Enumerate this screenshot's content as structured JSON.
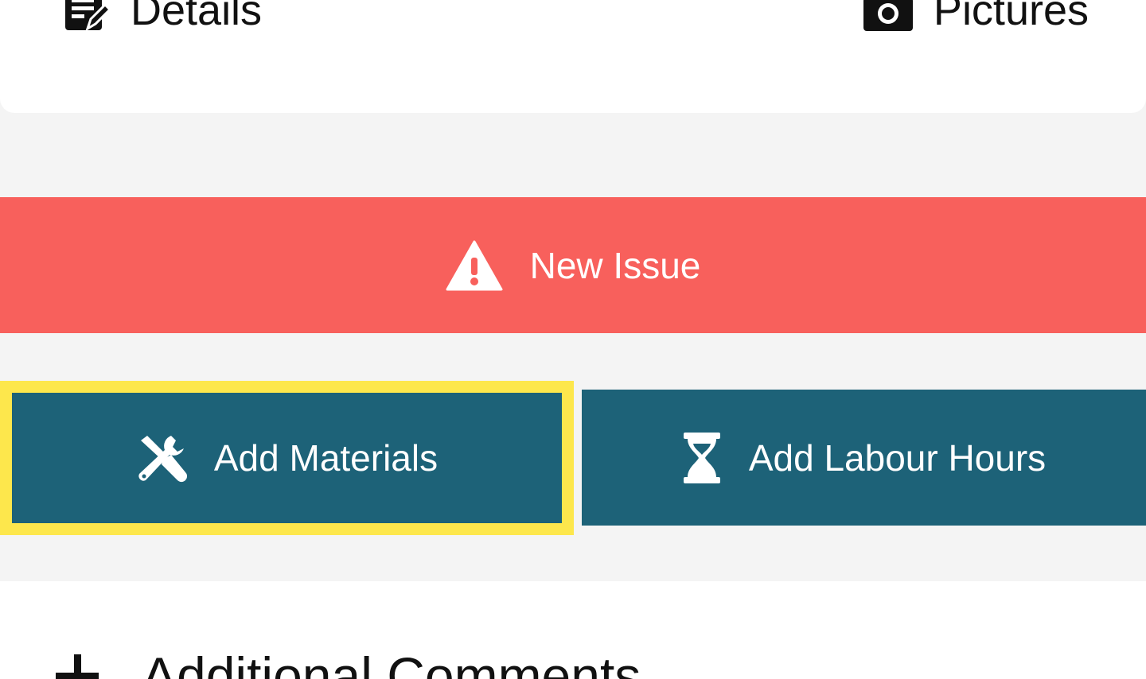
{
  "tabs": {
    "details": {
      "label": "Details",
      "icon": "edit-document-icon"
    },
    "pictures": {
      "label": "Pictures",
      "icon": "camera-icon"
    }
  },
  "actions": {
    "new_issue": {
      "label": "New Issue",
      "icon": "warning-triangle-icon",
      "color": "#f8605c"
    },
    "add_materials": {
      "label": "Add Materials",
      "icon": "tools-icon",
      "color": "#1d6278",
      "highlight": "#fde74c"
    },
    "add_labour_hours": {
      "label": "Add Labour Hours",
      "icon": "hourglass-icon",
      "color": "#1d6278"
    }
  },
  "comments": {
    "label": "Additional Comments",
    "icon": "plus-icon"
  }
}
